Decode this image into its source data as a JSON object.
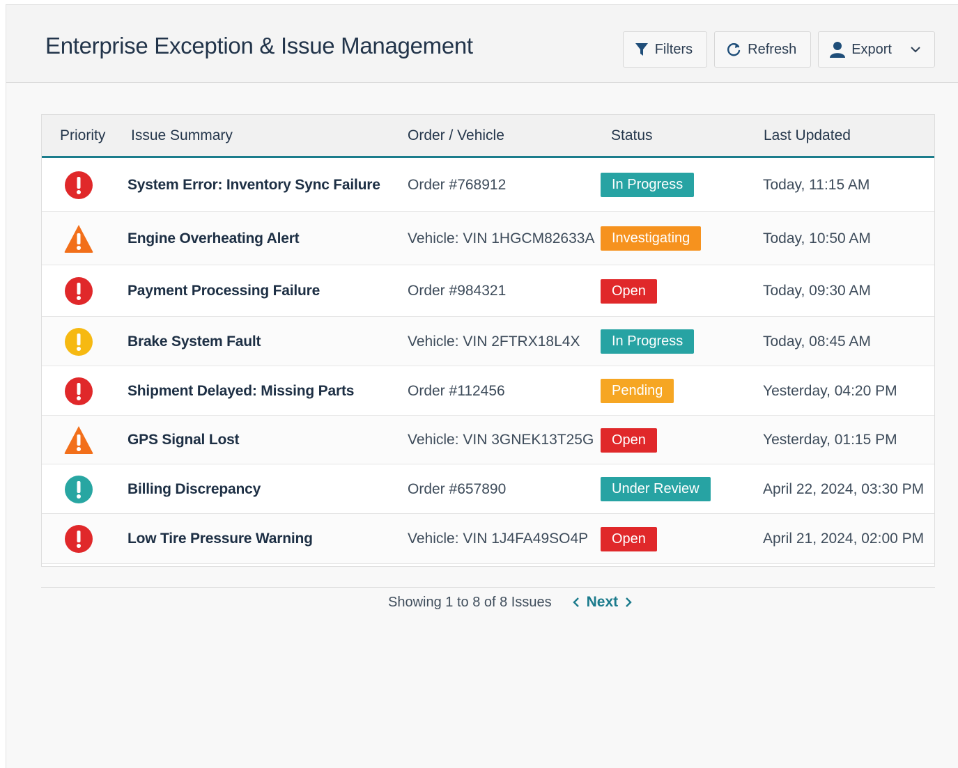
{
  "header": {
    "title": "Enterprise Exception & Issue Management",
    "buttons": {
      "filters": "Filters",
      "refresh": "Refresh",
      "export": "Export"
    }
  },
  "table": {
    "columns": [
      "Priority",
      "Issue Summary",
      "Order / Vehicle",
      "Status",
      "Last Updated"
    ],
    "rows": [
      {
        "priority": "critical",
        "icon": "alert-circle-icon",
        "icon_color": "#e0282a",
        "summary": "System Error: Inventory Sync Failure",
        "ref": "Order #768912",
        "status": "In Progress",
        "status_color": "#27a3a3",
        "updated": "Today, 11:15 AM"
      },
      {
        "priority": "high",
        "icon": "warning-triangle-icon",
        "icon_color": "#f26f1a",
        "summary": "Engine Overheating Alert",
        "ref": "Vehicle: VIN 1HGCM82633A",
        "status": "Investigating",
        "status_color": "#f6921e",
        "updated": "Today, 10:50 AM"
      },
      {
        "priority": "critical",
        "icon": "alert-circle-icon",
        "icon_color": "#e0282a",
        "summary": "Payment Processing Failure",
        "ref": "Order #984321",
        "status": "Open",
        "status_color": "#e0282a",
        "updated": "Today, 09:30 AM"
      },
      {
        "priority": "medium",
        "icon": "alert-circle-icon",
        "icon_color": "#f6b912",
        "summary": "Brake System Fault",
        "ref": "Vehicle: VIN 2FTRX18L4X",
        "status": "In Progress",
        "status_color": "#27a3a3",
        "updated": "Today, 08:45 AM"
      },
      {
        "priority": "critical",
        "icon": "alert-circle-icon",
        "icon_color": "#e0282a",
        "summary": "Shipment Delayed: Missing Parts",
        "ref": "Order #112456",
        "status": "Pending",
        "status_color": "#f6a623",
        "updated": "Yesterday, 04:20 PM"
      },
      {
        "priority": "high",
        "icon": "warning-triangle-icon",
        "icon_color": "#f26f1a",
        "summary": "GPS Signal Lost",
        "ref": "Vehicle: VIN 3GNEK13T25G",
        "status": "Open",
        "status_color": "#e0282a",
        "updated": "Yesterday, 01:15 PM"
      },
      {
        "priority": "low",
        "icon": "alert-circle-icon",
        "icon_color": "#28a6a2",
        "summary": "Billing Discrepancy",
        "ref": "Order #657890",
        "status": "Under Review",
        "status_color": "#27a3a3",
        "updated": "April 22, 2024, 03:30 PM"
      },
      {
        "priority": "critical",
        "icon": "alert-circle-icon",
        "icon_color": "#e0282a",
        "summary": "Low Tire Pressure Warning",
        "ref": "Vehicle: VIN 1J4FA49SO4P",
        "status": "Open",
        "status_color": "#e0282a",
        "updated": "April 21, 2024, 02:00 PM"
      }
    ]
  },
  "pagination": {
    "summary": "Showing 1 to 8 of 8 Issues",
    "next_label": "Next"
  },
  "colors": {
    "accent": "#1c7d8c",
    "title": "#22344a"
  }
}
